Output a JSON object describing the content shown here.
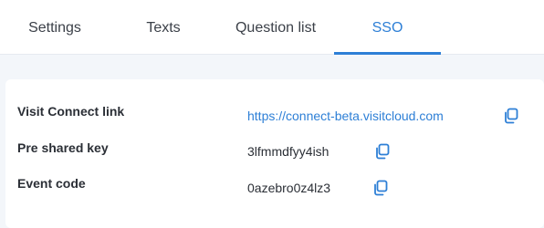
{
  "tabs": [
    {
      "label": "Settings",
      "active": false
    },
    {
      "label": "Texts",
      "active": false
    },
    {
      "label": "Question list",
      "active": false
    },
    {
      "label": "SSO",
      "active": true
    }
  ],
  "sso": {
    "rows": [
      {
        "label": "Visit Connect link",
        "value": "https://connect-beta.visitcloud.com",
        "is_link": true,
        "icon": "copy-icon"
      },
      {
        "label": "Pre shared key",
        "value": "3lfmmdfyy4ish",
        "is_link": false,
        "icon": "copy-icon"
      },
      {
        "label": "Event code",
        "value": "0azebro0z4lz3",
        "is_link": false,
        "icon": "copy-icon"
      }
    ]
  },
  "colors": {
    "accent": "#2d7fd6",
    "page_background": "#f3f6fa",
    "text": "#2b2f36"
  }
}
